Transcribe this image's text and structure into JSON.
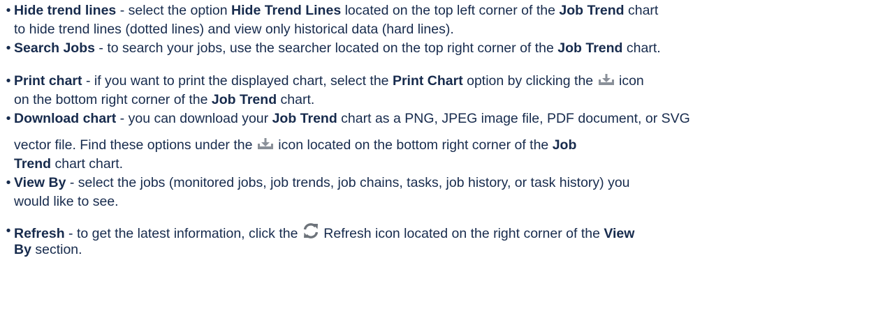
{
  "bullets": {
    "hide_trend": {
      "title": "Hide trend lines",
      "t1": " - select the option ",
      "b1": "Hide Trend Lines",
      "t2": " located on the top left corner of the ",
      "b2": "Job Trend",
      "t3": " chart",
      "line2": "to hide trend lines (dotted lines) and view only historical data (hard lines)."
    },
    "search_jobs": {
      "title": "Search Jobs",
      "t1": " - to search your jobs, use the searcher located on the top right corner of the ",
      "b1": "Job Trend",
      "t2": " chart."
    },
    "print_chart": {
      "title": "Print chart",
      "t1": " - if you want to print the displayed chart, select the ",
      "b1": "Print Chart",
      "t2": " option by clicking the ",
      "t3": " icon",
      "line2_t1": "on the bottom right corner of the ",
      "line2_b1": "Job Trend",
      "line2_t2": " chart."
    },
    "download_chart": {
      "title": "Download chart",
      "t1": " - you can download your ",
      "b1": "Job Trend",
      "t2": " chart as a PNG, JPEG image file, PDF document, or SVG",
      "line2_t1": "vector file. Find these options under the ",
      "line2_t2": " icon located on the bottom right corner of the ",
      "line2_b1": "Job",
      "line3_b1": "Trend",
      "line3_t1": " chart chart."
    },
    "view_by": {
      "title": "View By",
      "t1": " -  select the jobs (monitored jobs, job trends, job chains, tasks, job history, or task history) you",
      "line2": "would like to see."
    },
    "refresh": {
      "title": "Refresh",
      "t1": " - to get the latest information, click the ",
      "t2": " Refresh icon located on the right corner of the ",
      "b1": "View",
      "line2_b1": "By",
      "line2_t1": " section."
    }
  },
  "bullet_glyph": "•",
  "icons": {
    "download": "download-tray-icon",
    "refresh": "refresh-icon"
  },
  "colors": {
    "text": "#172b4d",
    "icon_gray": "#8a9099",
    "refresh_gray": "#6d737a"
  }
}
